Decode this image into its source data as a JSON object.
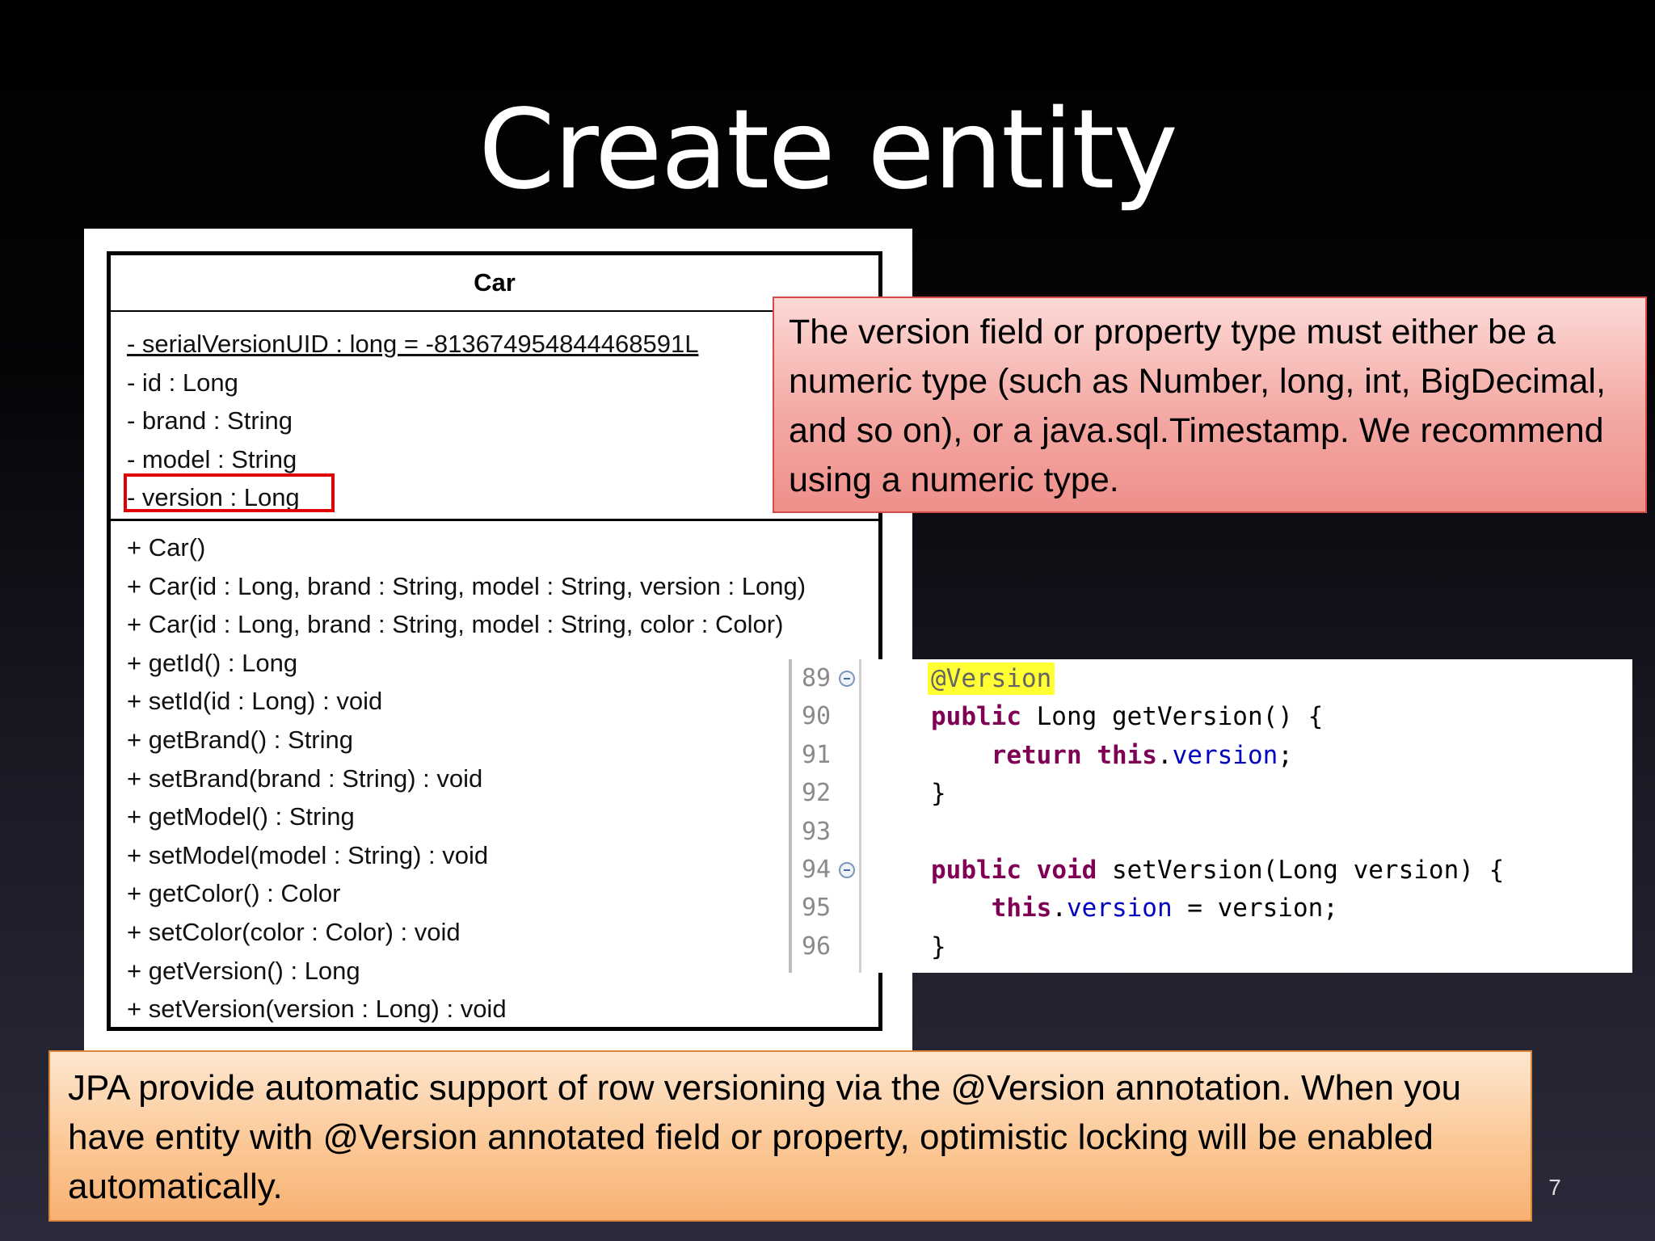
{
  "slide": {
    "title": "Create entity",
    "page_number": "7"
  },
  "uml": {
    "class_name": "Car",
    "attributes": [
      "- serialVersionUID : long = -8136749548444685​91L",
      "- id : Long",
      "- brand : String",
      "- model : String",
      "- version : Long"
    ],
    "methods": [
      "+ Car()",
      "+ Car(id : Long, brand : String, model : String, version : Long)",
      "+ Car(id : Long, brand : String, model : String, color : Color)",
      "+ getId() : Long",
      "+ setId(id : Long) : void",
      "+ getBrand() : String",
      "+ setBrand(brand : String) : void",
      "+ getModel() : String",
      "+ setModel(model : String) : void",
      "+ getColor() : Color",
      "+ setColor(color : Color) : void",
      "+ getVersion() : Long",
      "+ setVersion(version : Long) : void"
    ],
    "highlight_color": "#e00000"
  },
  "callout_red": {
    "text": "The version field or property type must either be a numeric type (such as Number, long, int, BigDecimal, and so on), or a java.sql.Timestamp. We recommend using a numeric type."
  },
  "callout_orange": {
    "text": "JPA provide automatic support of row versioning via the @Version annotation. When you have entity with @Version annotated field or property, optimistic locking will be enabled automatically."
  },
  "code": {
    "line_numbers": [
      "89",
      "90",
      "91",
      "92",
      "93",
      "94",
      "95",
      "96"
    ],
    "l89_anno": "@Version",
    "l90_kw": "public",
    "l90_rest": " Long getVersion() {",
    "l91_indent": "    ",
    "l91_kw1": "return",
    "l91_sp": " ",
    "l91_kw2": "this",
    "l91_dot": ".",
    "l91_fld": "version",
    "l91_end": ";",
    "l92": "}",
    "l94_kw1": "public",
    "l94_sp": " ",
    "l94_kw2": "void",
    "l94_rest": " setVersion(Long version) {",
    "l95_indent": "    ",
    "l95_kw": "this",
    "l95_dot": ".",
    "l95_fld": "version",
    "l95_rest": " = version;",
    "l96": "}",
    "colors": {
      "keyword": "#7f0055",
      "field": "#0000c0",
      "annotation_bg": "#ffff33"
    }
  }
}
